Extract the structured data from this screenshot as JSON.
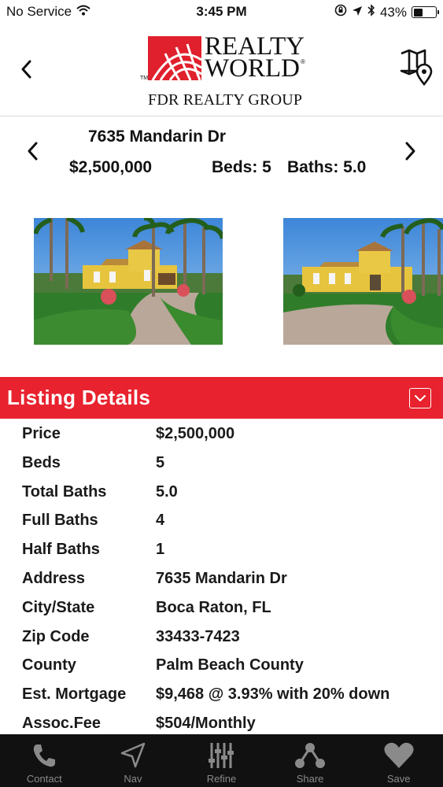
{
  "status_bar": {
    "carrier": "No Service",
    "time": "3:45 PM",
    "battery": "43%",
    "battery_level": 0.43
  },
  "header": {
    "logo": {
      "line1": "REALTY",
      "line2": "WORLD",
      "tm": "TM",
      "registered": "®",
      "tagline": "FDR REALTY GROUP"
    },
    "back_icon": "chevron-left-icon",
    "map_icon": "map-pin-icon"
  },
  "summary": {
    "address": "7635 Mandarin Dr",
    "price": "$2,500,000",
    "beds": "Beds: 5",
    "baths": "Baths: 5.0"
  },
  "details": {
    "title": "Listing Details",
    "rows": [
      {
        "label": "Price",
        "value": "$2,500,000"
      },
      {
        "label": "Beds",
        "value": "5"
      },
      {
        "label": "Total Baths",
        "value": "5.0"
      },
      {
        "label": "Full Baths",
        "value": "4"
      },
      {
        "label": "Half Baths",
        "value": "1"
      },
      {
        "label": "Address",
        "value": "7635 Mandarin Dr"
      },
      {
        "label": "City/State",
        "value": "Boca Raton, FL"
      },
      {
        "label": "Zip Code",
        "value": "33433-7423"
      },
      {
        "label": "County",
        "value": "Palm Beach County"
      },
      {
        "label": "Est. Mortgage",
        "value": "$9,468 @ 3.93% with 20% down"
      },
      {
        "label": "Assoc.Fee",
        "value": "$504/Monthly"
      }
    ]
  },
  "tabs": [
    {
      "label": "Contact",
      "icon": "phone-icon"
    },
    {
      "label": "Nav",
      "icon": "navigation-arrow-icon"
    },
    {
      "label": "Refine",
      "icon": "sliders-icon"
    },
    {
      "label": "Share",
      "icon": "share-icon"
    },
    {
      "label": "Save",
      "icon": "heart-icon"
    }
  ],
  "colors": {
    "accent": "#e8222e",
    "tab_bar": "#111111",
    "tab_label": "#8a8a8a"
  }
}
